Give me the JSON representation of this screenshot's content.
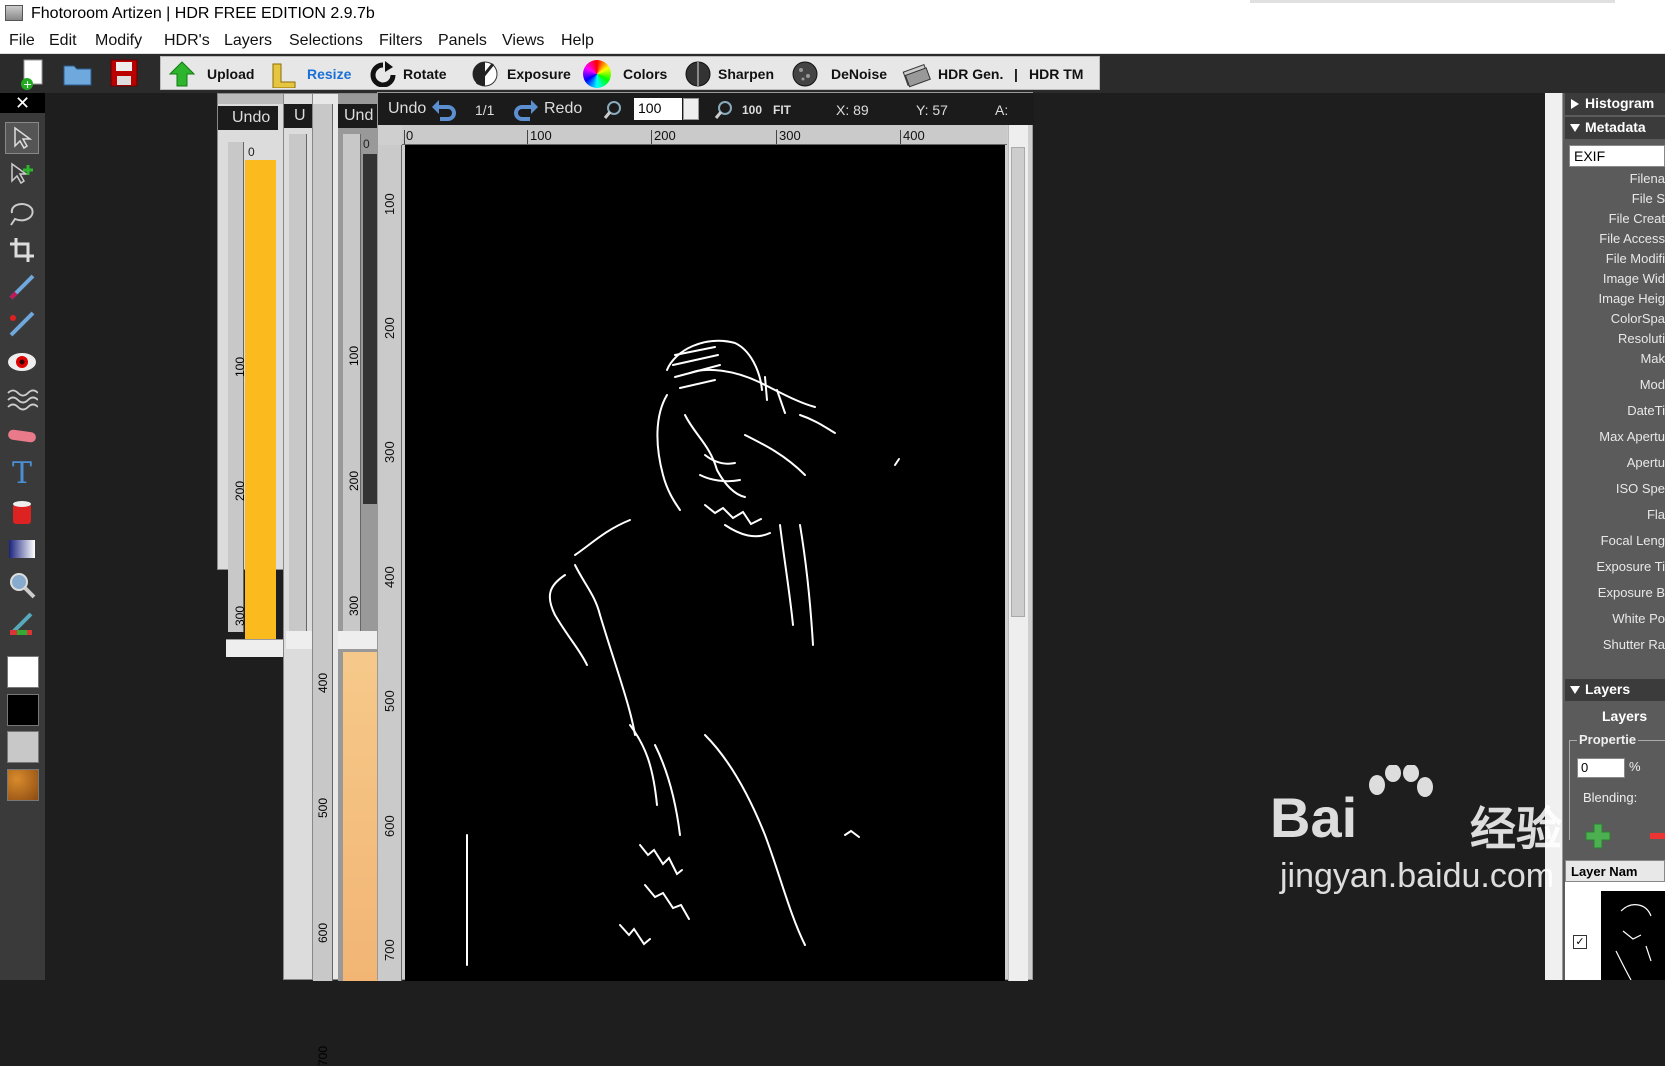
{
  "window": {
    "title": "Fhotoroom Artizen | HDR FREE EDITION 2.9.7b"
  },
  "menu": [
    "File",
    "Edit",
    "Modify",
    "HDR's",
    "Layers",
    "Selections",
    "Filters",
    "Panels",
    "Views",
    "Help"
  ],
  "toolbar": {
    "buttons": [
      "Upload",
      "Resize",
      "Rotate",
      "Exposure",
      "Colors",
      "Sharpen",
      "DeNoise",
      "HDR Gen.",
      "|",
      "HDR TM"
    ],
    "active": "Resize"
  },
  "left_tools": [
    "pointer-icon",
    "add-pointer-icon",
    "lasso-icon",
    "crop-icon",
    "brush-icon",
    "red-brush-icon",
    "red-eye-icon",
    "wave-icon",
    "eraser-icon",
    "text-icon",
    "bucket-icon",
    "gradient-icon",
    "zoom-icon",
    "eyedropper-icon"
  ],
  "left_close": "✕",
  "back_docs": {
    "doc1": {
      "undo": "Undo",
      "ruler_top": "0",
      "ruler": [
        "100",
        "200",
        "300"
      ]
    },
    "doc2": {
      "undo": "U",
      "ruler": [
        "100",
        "200",
        "300",
        "400",
        "500",
        "600",
        "700"
      ]
    },
    "doc3": {
      "undo": "Und",
      "ruler_top": "0",
      "ruler": [
        "100",
        "200",
        "300"
      ]
    }
  },
  "doc": {
    "undo": "Undo",
    "page": "1/1",
    "redo": "Redo",
    "zoom": "100",
    "zoom100": "100",
    "fit": "FIT",
    "x": "X: 89",
    "y": "Y: 57",
    "a": "A:",
    "hruler": [
      "0",
      "100",
      "200",
      "300",
      "400"
    ],
    "vruler": [
      "100",
      "200",
      "300",
      "400",
      "500",
      "600",
      "700"
    ]
  },
  "right_panel": {
    "histogram": "Histogram",
    "metadata": "Metadata",
    "exif": "EXIF",
    "fields": [
      "Filena",
      "File S",
      "File Creat",
      "File Access",
      "File Modifi",
      "Image Wid",
      "Image Heig",
      "ColorSpa",
      "Resoluti",
      "Mak",
      "Mod",
      "DateTi",
      "Max Apertu",
      "Apertu",
      "ISO Spe",
      "Fla",
      "Focal Leng",
      "Exposure Ti",
      "Exposure B",
      "White Po",
      "Shutter Ra"
    ],
    "layers": "Layers",
    "layers_title": "Layers",
    "properties": "Propertie",
    "opacity": "0",
    "percent": "%",
    "blending": "Blending:",
    "layer_name": "Layer Nam"
  },
  "watermark": {
    "brand": "Bai",
    "brand2": "经验",
    "url": "jingyan.baidu.com"
  }
}
